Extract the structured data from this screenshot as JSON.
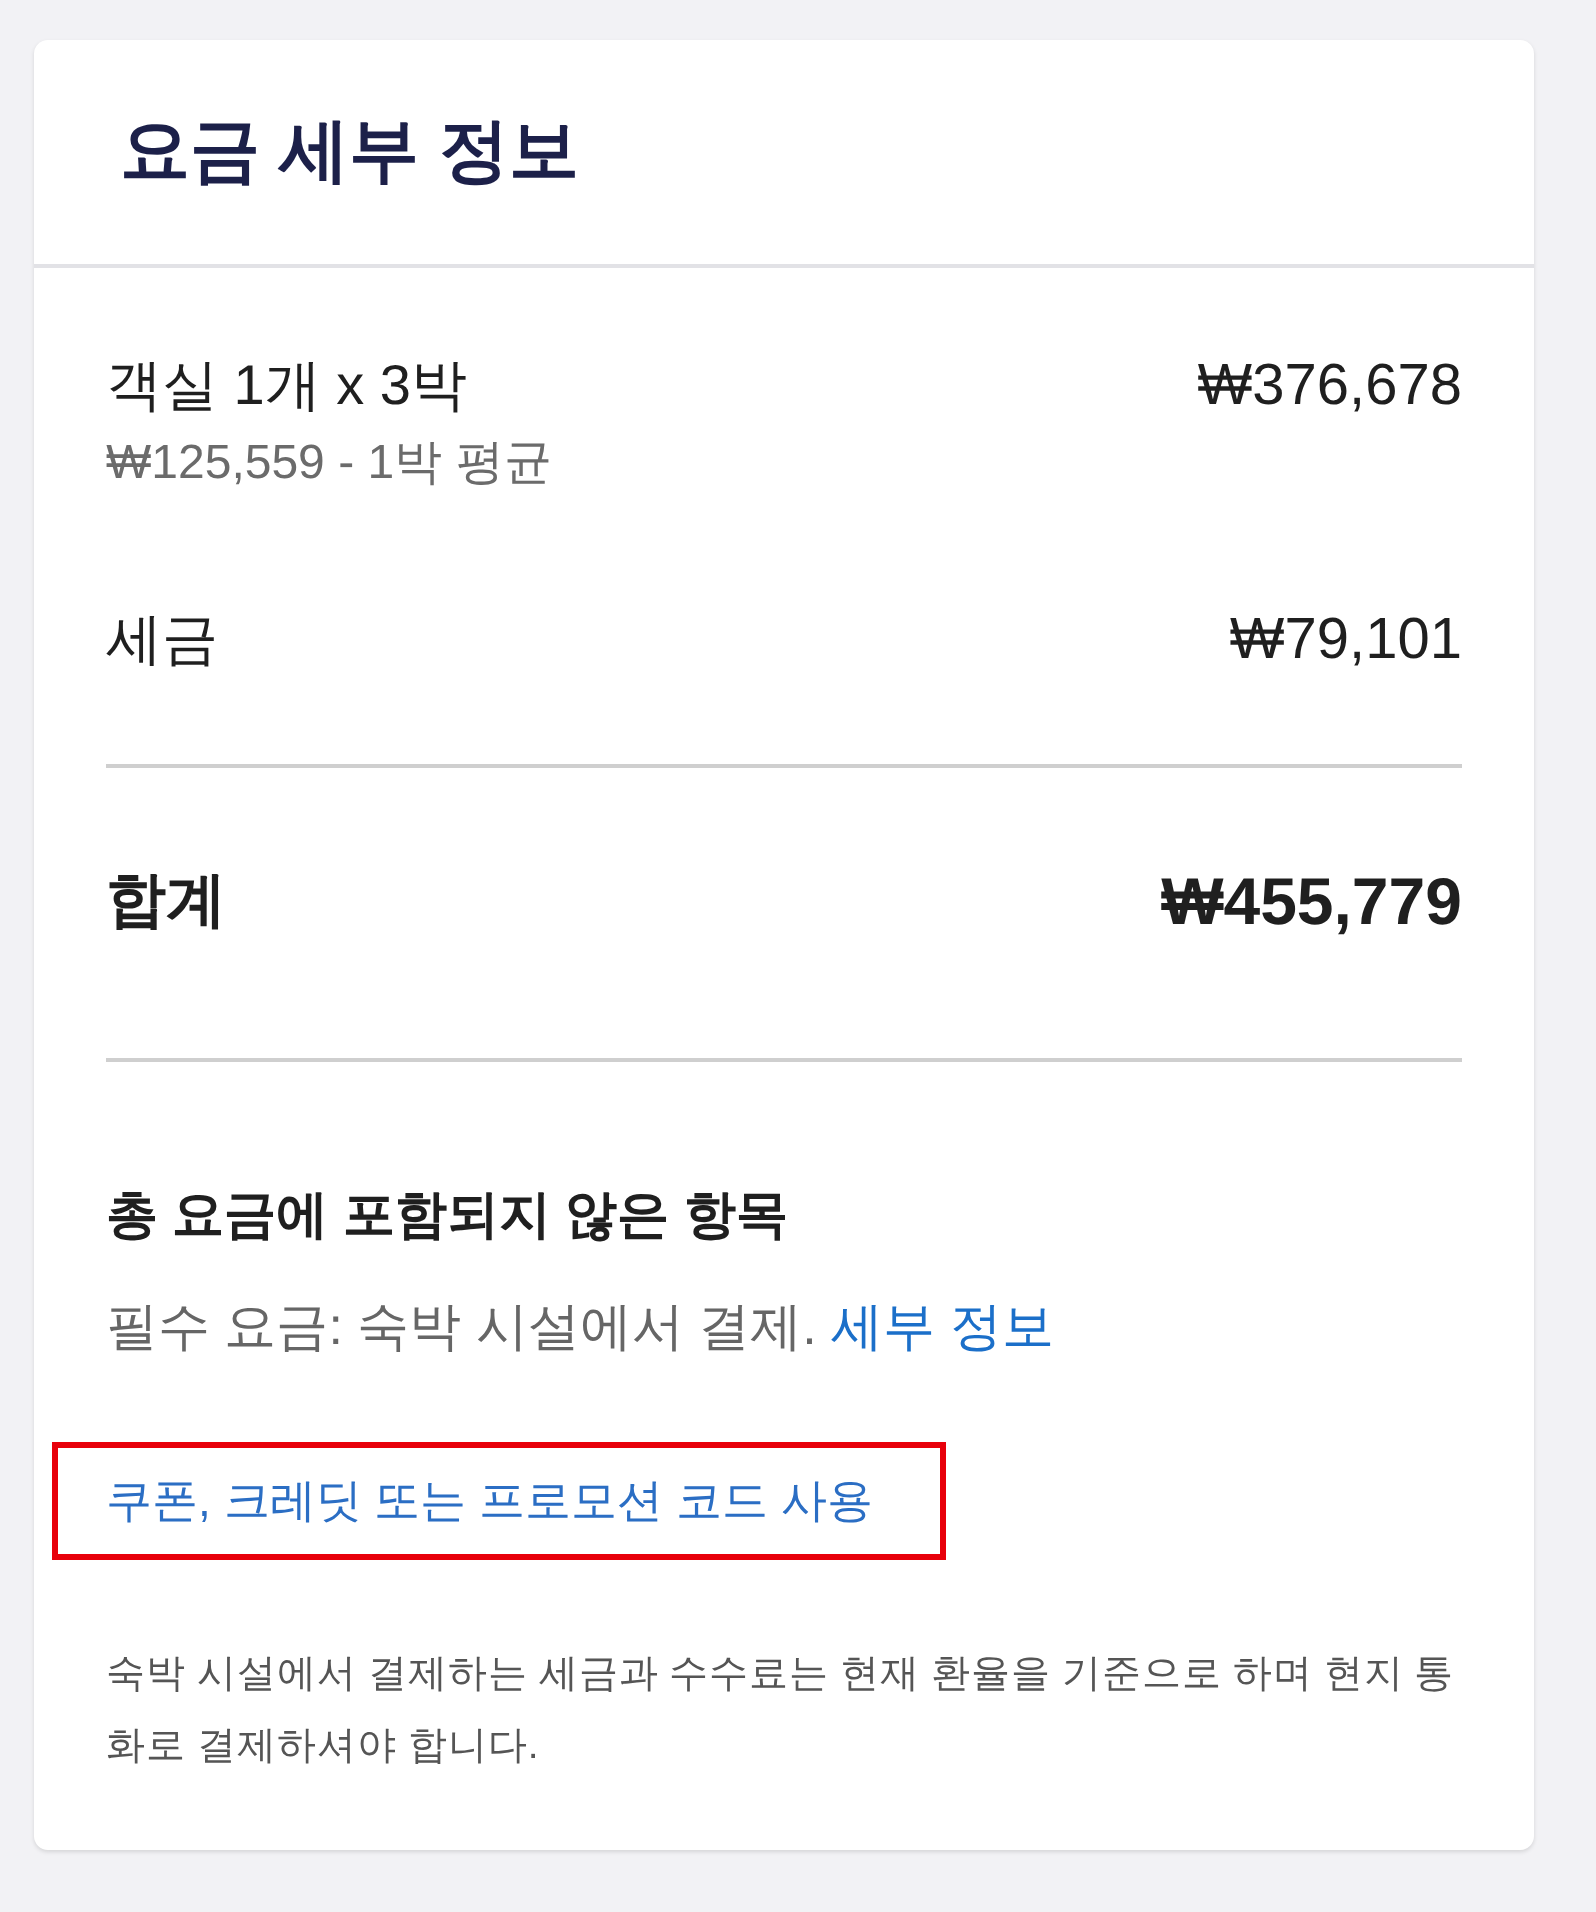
{
  "title": "요금 세부 정보",
  "line_items": [
    {
      "label": "객실 1개 x 3박",
      "detail": "₩125,559 - 1박 평균",
      "amount": "₩376,678"
    },
    {
      "label": "세금",
      "amount": "₩79,101"
    }
  ],
  "total": {
    "label": "합계",
    "amount": "₩455,779"
  },
  "not_included": {
    "heading": "총 요금에 포함되지 않은 항목",
    "text": "필수 요금: 숙박 시설에서 결제.",
    "link": "세부 정보"
  },
  "coupon_link": {
    "label": "쿠폰, 크레딧 또는 프로모션 코드 사용",
    "highlighted": true
  },
  "footnote": "숙박 시설에서 결제하는 세금과 수수료는 현재 환율을 기준으로 하며 현지 통화로 결제하셔야 합니다."
}
